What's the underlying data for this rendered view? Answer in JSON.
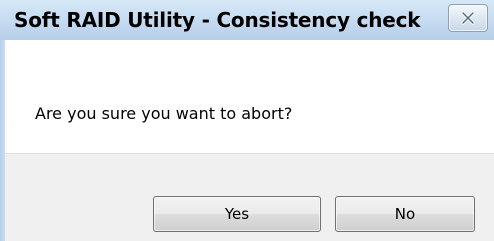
{
  "dialog": {
    "title": "Soft RAID Utility - Consistency check",
    "message": "Are you sure you want to abort?",
    "buttons": {
      "yes": "Yes",
      "no": "No"
    },
    "close_icon": "close-icon"
  }
}
